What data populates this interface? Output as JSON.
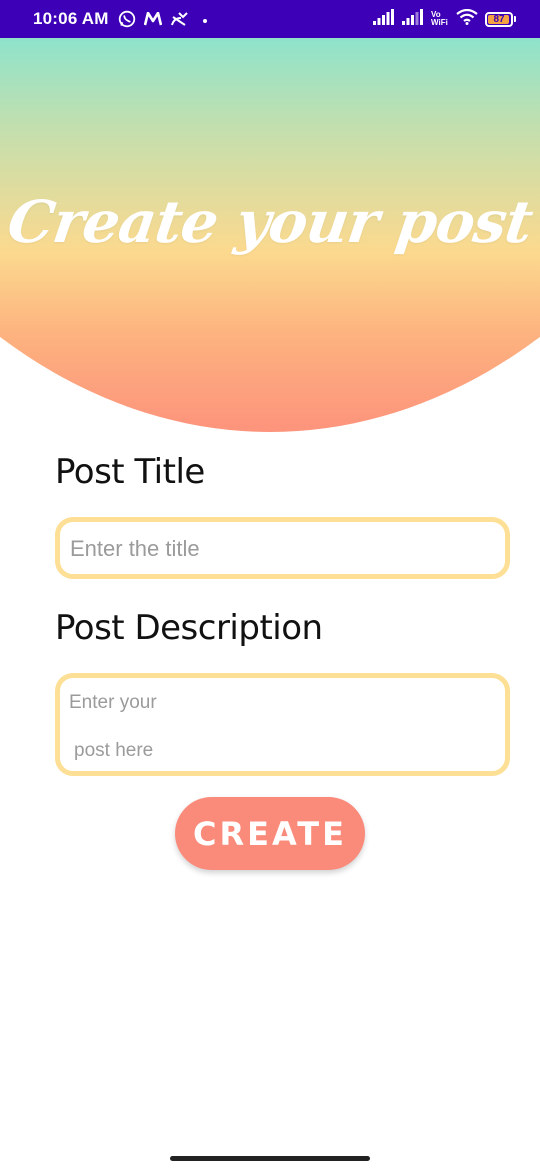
{
  "status_bar": {
    "time": "10:06 AM",
    "left_icons": [
      "whatsapp-icon",
      "m-icon",
      "missed-call-icon",
      "dot-icon"
    ],
    "vowifi_top": "Vo",
    "vowifi_bottom": "WiFi",
    "battery_level": "87",
    "background_color": "#3d00b7"
  },
  "header": {
    "title": "Create your post",
    "gradient_colors": [
      "#8ee3cb",
      "#fcd98e",
      "#fd937c"
    ]
  },
  "form": {
    "title_label": "Post Title",
    "title_placeholder": "Enter the title",
    "description_label": "Post Description",
    "description_placeholder_line1": "Enter your",
    "description_placeholder_line2": "post here",
    "input_border_color": "#fddf95"
  },
  "actions": {
    "create_label": "CREATE",
    "button_color": "#fa8a7a"
  }
}
